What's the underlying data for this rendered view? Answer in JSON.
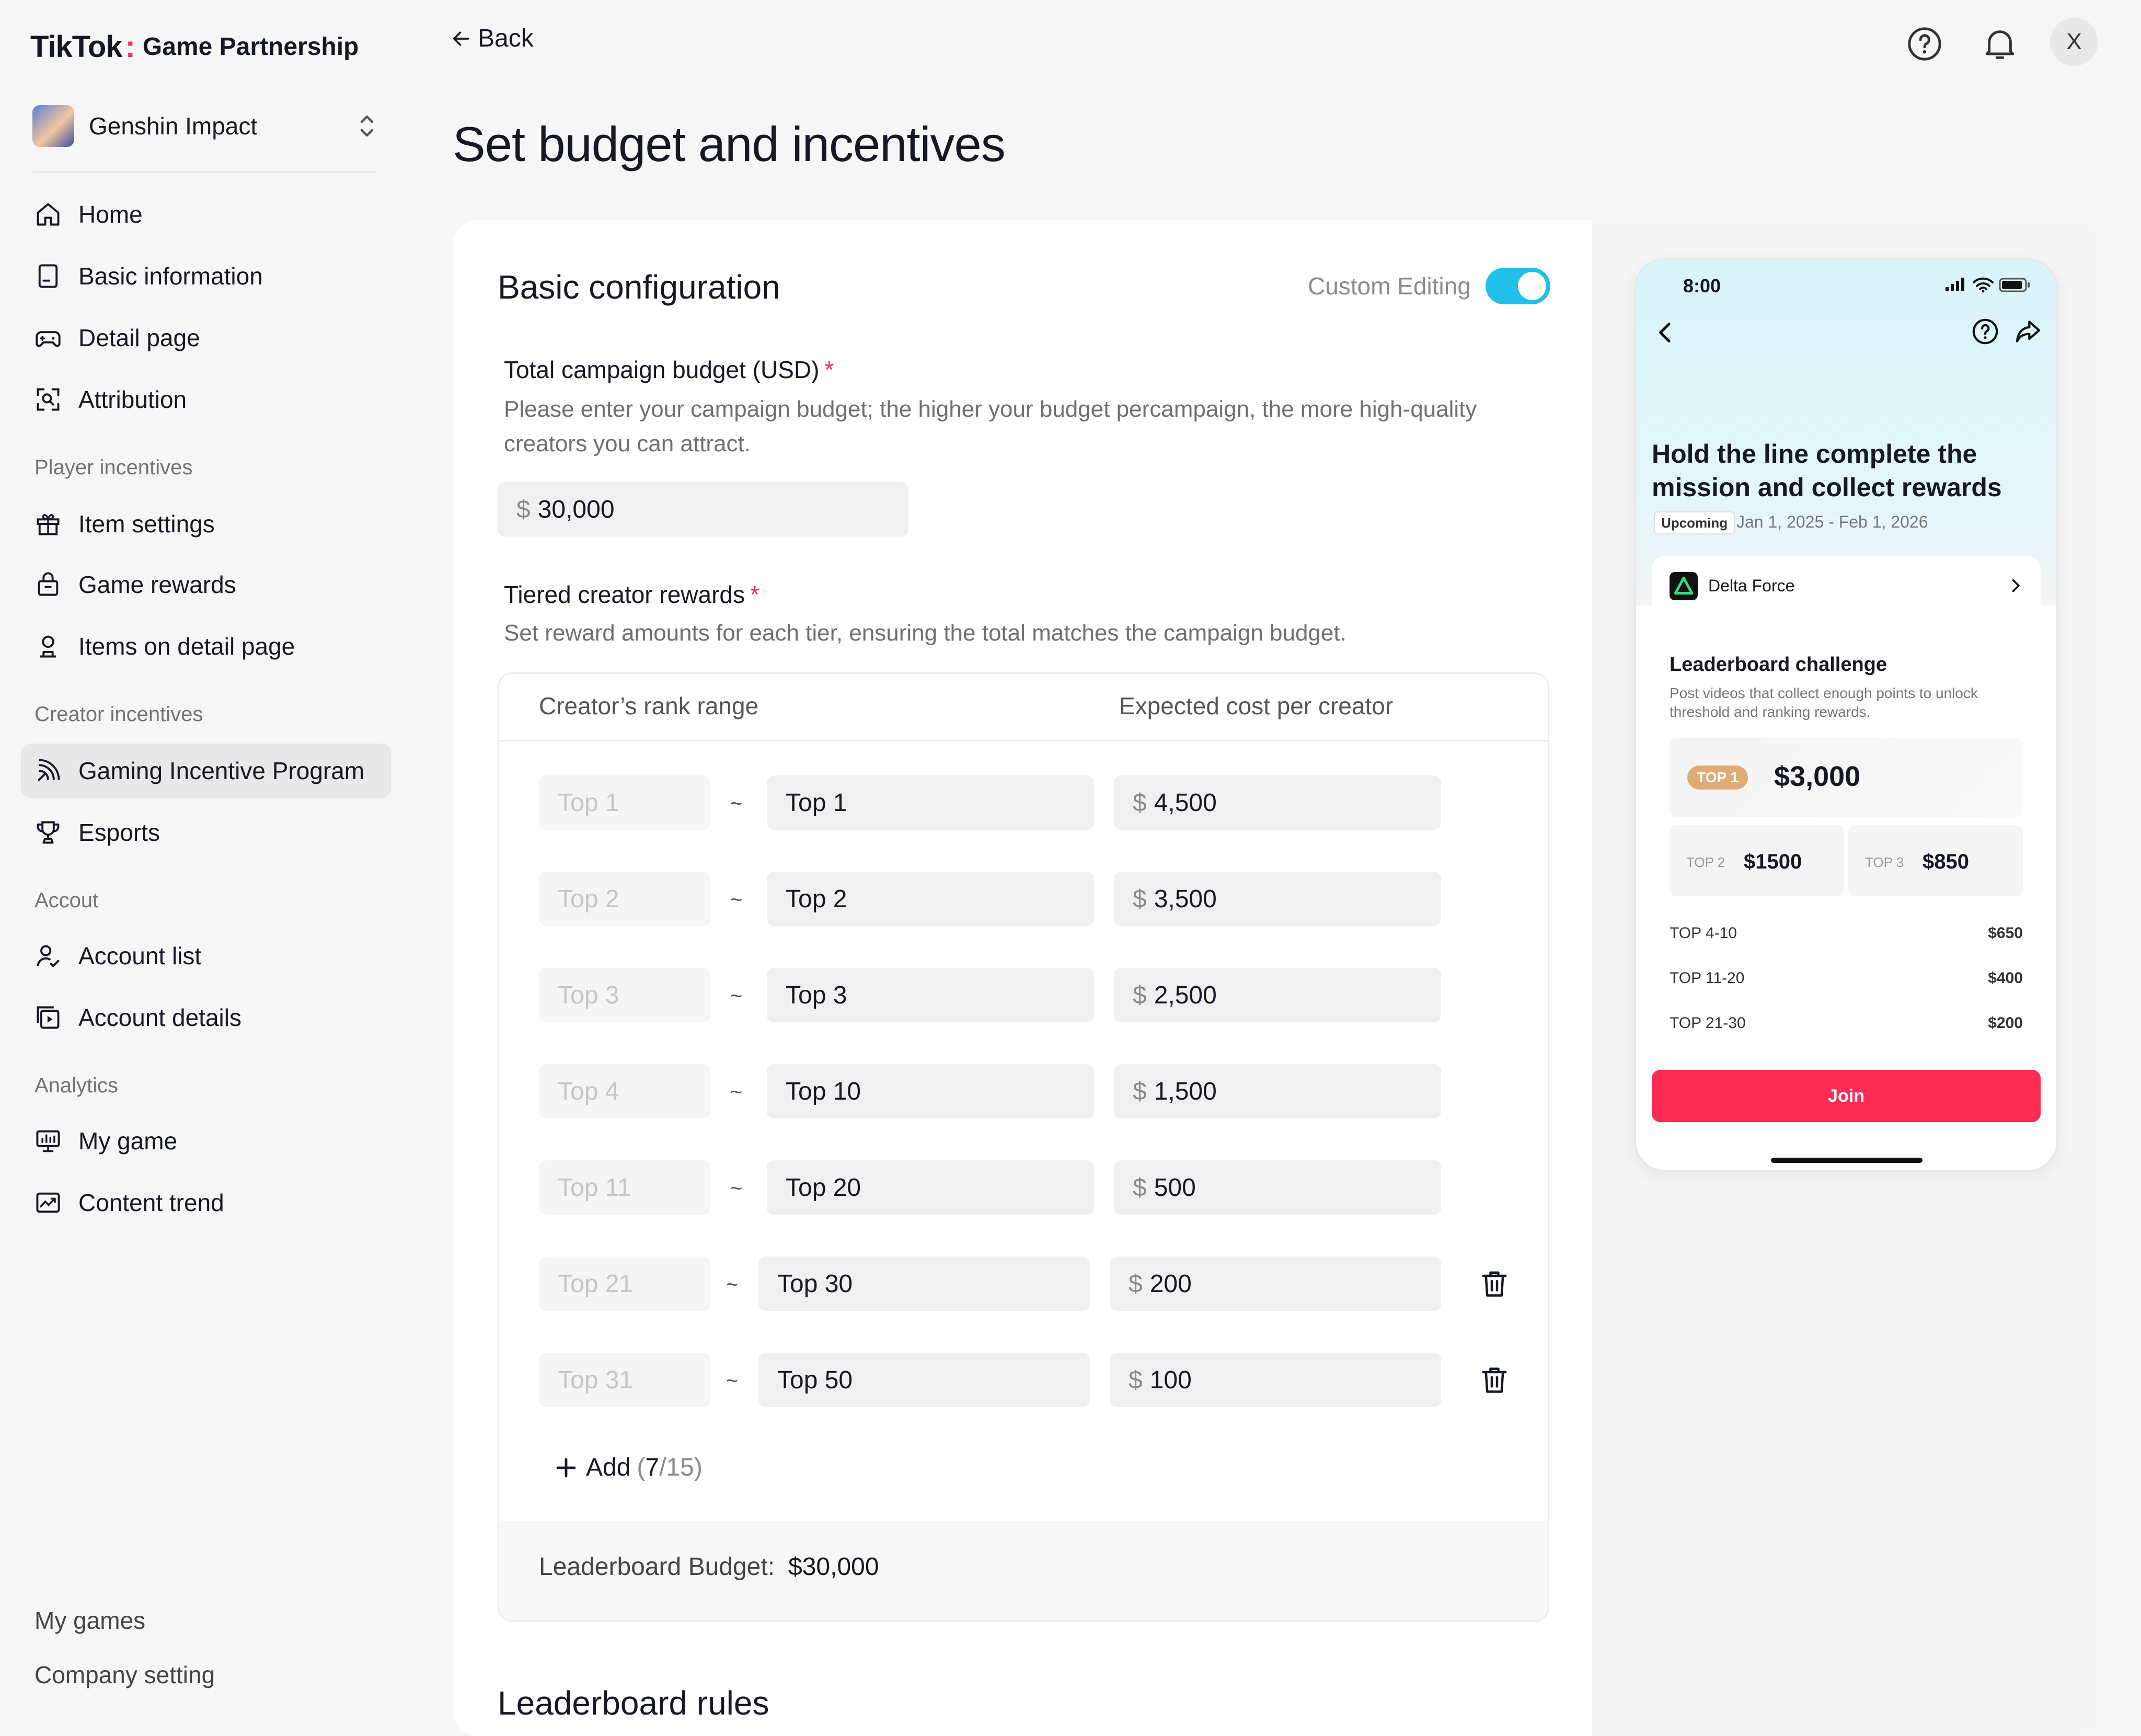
{
  "brand": {
    "tiktok": "TikTok",
    "product": "Game Partnership"
  },
  "game_switch": {
    "name": "Genshin Impact"
  },
  "sidebar": {
    "items": [
      {
        "label": "Home",
        "icon": "home-icon"
      },
      {
        "label": "Basic information",
        "icon": "document-icon"
      },
      {
        "label": "Detail page",
        "icon": "gamepad-icon"
      },
      {
        "label": "Attribution",
        "icon": "scan-icon"
      }
    ],
    "groups": {
      "player": "Player incentives",
      "creator": "Creator incentives",
      "account": "Accout",
      "analytics": "Analytics"
    },
    "player_items": [
      {
        "label": "Item settings",
        "icon": "gift-icon"
      },
      {
        "label": "Game rewards",
        "icon": "bag-icon"
      },
      {
        "label": "Items on detail page",
        "icon": "user-icon"
      }
    ],
    "creator_items": [
      {
        "label": "Gaming Incentive Program",
        "icon": "broadcast-icon",
        "active": true
      },
      {
        "label": "Esports",
        "icon": "trophy-icon"
      }
    ],
    "account_items": [
      {
        "label": "Account list",
        "icon": "person-check-icon"
      },
      {
        "label": "Account details",
        "icon": "video-stack-icon"
      }
    ],
    "analytics_items": [
      {
        "label": "My game",
        "icon": "monitor-icon"
      },
      {
        "label": "Content trend",
        "icon": "trend-icon"
      }
    ],
    "footer": {
      "my_games": "My games",
      "company": "Company setting"
    }
  },
  "topbar": {
    "back": "Back",
    "avatar": "X"
  },
  "page_title": "Set budget and incentives",
  "config": {
    "title": "Basic configuration",
    "custom_editing": "Custom Editing",
    "custom_editing_on": true,
    "budget_label": "Total campaign budget (USD)",
    "budget_desc": "Please enter your campaign budget; the higher your budget percampaign, the more high-quality creators you can attract.",
    "currency": "$",
    "budget_value": "30,000",
    "tiers_label": "Tiered creator rewards",
    "tiers_desc": "Set reward amounts for each tier, ensuring the total matches the campaign budget.",
    "col_rank": "Creator’s rank range",
    "col_cost": "Expected cost per creator",
    "tilde": "~",
    "tiers": [
      {
        "from": "Top 1",
        "to": "Top 1",
        "cost": "4,500"
      },
      {
        "from": "Top 2",
        "to": "Top 2",
        "cost": "3,500"
      },
      {
        "from": "Top 3",
        "to": "Top 3",
        "cost": "2,500"
      },
      {
        "from": "Top 4",
        "to": "Top 10",
        "cost": "1,500"
      },
      {
        "from": "Top 11",
        "to": "Top 20",
        "cost": "500"
      },
      {
        "from": "Top 21",
        "to": "Top 30",
        "cost": "200"
      },
      {
        "from": "Top 31",
        "to": "Top 50",
        "cost": "100"
      }
    ],
    "add_label": "Add",
    "add_open": "(",
    "add_used": "7",
    "add_rest": "/15)",
    "leaderboard_budget_label": "Leaderboard Budget:",
    "leaderboard_budget_value": "$30,000",
    "rules_title": "Leaderboard rules"
  },
  "phone": {
    "time": "8:00",
    "title": "Hold the line complete the mission and collect rewards",
    "badge": "Upcoming",
    "dates": "Jan 1, 2025 - Feb 1, 2026",
    "game": "Delta Force",
    "lb_title": "Leaderboard challenge",
    "lb_desc": "Post videos that collect enough points to unlock threshold and ranking rewards.",
    "top1_tag": "TOP 1",
    "top1_amt": "$3,000",
    "top2_tag": "TOP 2",
    "top2_amt": "$1500",
    "top3_tag": "TOP 3",
    "top3_amt": "$850",
    "rows": [
      {
        "label": "TOP 4-10",
        "value": "$650"
      },
      {
        "label": "TOP 11-20",
        "value": "$400"
      },
      {
        "label": "TOP 21-30",
        "value": "$200"
      }
    ],
    "join": "Join"
  },
  "colors": {
    "accent": "#22c0e8",
    "brand_red": "#fe2c55",
    "gold": "#e0ab75"
  }
}
